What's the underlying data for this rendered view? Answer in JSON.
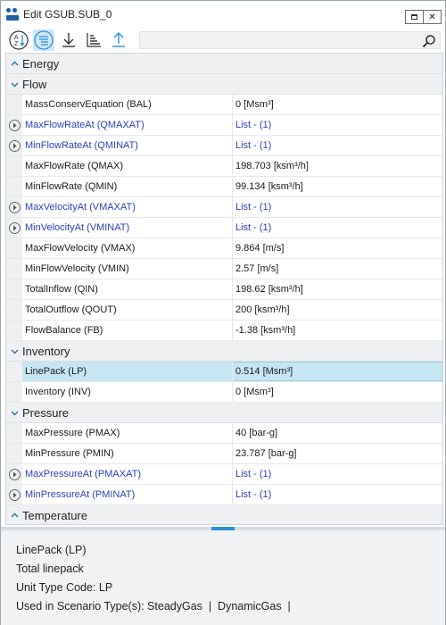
{
  "window": {
    "title": "Edit GSUB.SUB_0"
  },
  "toolbar": {
    "buttons": [
      {
        "name": "sort-alphabetical",
        "icon": "sort-az-icon"
      },
      {
        "name": "categorized",
        "icon": "list-icon",
        "active": true
      },
      {
        "name": "import",
        "icon": "download-icon"
      },
      {
        "name": "sort-descending",
        "icon": "sort-bars-icon"
      },
      {
        "name": "export",
        "icon": "upload-icon"
      }
    ],
    "search": {
      "placeholder": ""
    }
  },
  "grid": {
    "energy": {
      "label": "Energy"
    },
    "flow": {
      "label": "Flow",
      "rows": [
        {
          "name": "MassConservEquation (BAL)",
          "value": "0 [Msm³]"
        },
        {
          "name": "MaxFlowRateAt (QMAXAT)",
          "value": "List - (1)"
        },
        {
          "name": "MinFlowRateAt (QMINAT)",
          "value": "List - (1)"
        },
        {
          "name": "MaxFlowRate (QMAX)",
          "value": "198.703 [ksm³/h]"
        },
        {
          "name": "MinFlowRate (QMIN)",
          "value": "99.134 [ksm³/h]"
        },
        {
          "name": "MaxVelocityAt (VMAXAT)",
          "value": "List - (1)"
        },
        {
          "name": "MinVelocityAt (VMINAT)",
          "value": "List - (1)"
        },
        {
          "name": "MaxFlowVelocity (VMAX)",
          "value": "9.864 [m/s]"
        },
        {
          "name": "MinFlowVelocity (VMIN)",
          "value": "2.57 [m/s]"
        },
        {
          "name": "TotalInflow (QIN)",
          "value": "198.62 [ksm³/h]"
        },
        {
          "name": "TotalOutflow (QOUT)",
          "value": "200 [ksm³/h]"
        },
        {
          "name": "FlowBalance (FB)",
          "value": "-1.38 [ksm³/h]"
        }
      ]
    },
    "inventory": {
      "label": "Inventory",
      "rows": [
        {
          "name": "LinePack (LP)",
          "value": "0.514 [Msm³]"
        },
        {
          "name": "Inventory (INV)",
          "value": "0 [Msm³]"
        }
      ]
    },
    "pressure": {
      "label": "Pressure",
      "rows": [
        {
          "name": "MaxPressure (PMAX)",
          "value": "40 [bar-g]"
        },
        {
          "name": "MinPressure (PMIN)",
          "value": "23.787 [bar-g]"
        },
        {
          "name": "MaxPressureAt (PMAXAT)",
          "value": "List - (1)"
        },
        {
          "name": "MinPressureAt (PMINAT)",
          "value": "List - (1)"
        }
      ]
    },
    "temperature": {
      "label": "Temperature"
    }
  },
  "description": {
    "title": "LinePack (LP)",
    "text": "Total linepack",
    "unit_type": "Unit Type Code: LP",
    "scenario": "Used in Scenario Type(s): SteadyGas  |  DynamicGas  |"
  },
  "colors": {
    "accent": "#2c8fd6",
    "link": "#2a3fb8",
    "selected": "#c6e6f4"
  }
}
